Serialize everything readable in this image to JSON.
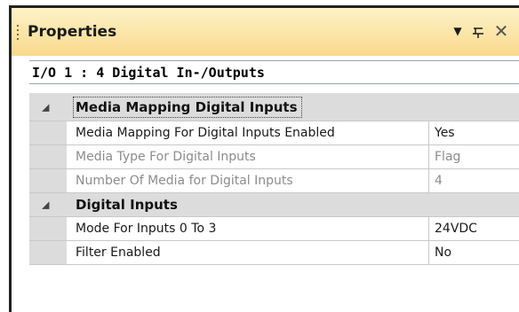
{
  "panel": {
    "title": "Properties",
    "icons": {
      "dropdown": "dropdown-arrow-icon",
      "pin": "pin-icon",
      "close": "close-icon"
    }
  },
  "object_selector": {
    "value": "I/O 1 : 4 Digital In-/Outputs"
  },
  "grid": {
    "categories": [
      {
        "label": "Media Mapping Digital Inputs",
        "expanded": true,
        "properties": [
          {
            "name": "Media Mapping For Digital Inputs Enabled",
            "value": "Yes",
            "enabled": true
          },
          {
            "name": "Media Type For Digital Inputs",
            "value": "Flag",
            "enabled": false
          },
          {
            "name": "Number Of Media for Digital Inputs",
            "value": "4",
            "enabled": false
          }
        ]
      },
      {
        "label": "Digital Inputs",
        "expanded": true,
        "properties": [
          {
            "name": "Mode For Inputs 0 To 3",
            "value": "24VDC",
            "enabled": true
          },
          {
            "name": "Filter Enabled",
            "value": "No",
            "enabled": true
          }
        ]
      }
    ]
  },
  "colors": {
    "titlebar_top": "#fdf3c8",
    "titlebar_bottom": "#f9d98c",
    "category_bg": "#dcdcdc",
    "disabled_text": "#8c8c8c"
  }
}
